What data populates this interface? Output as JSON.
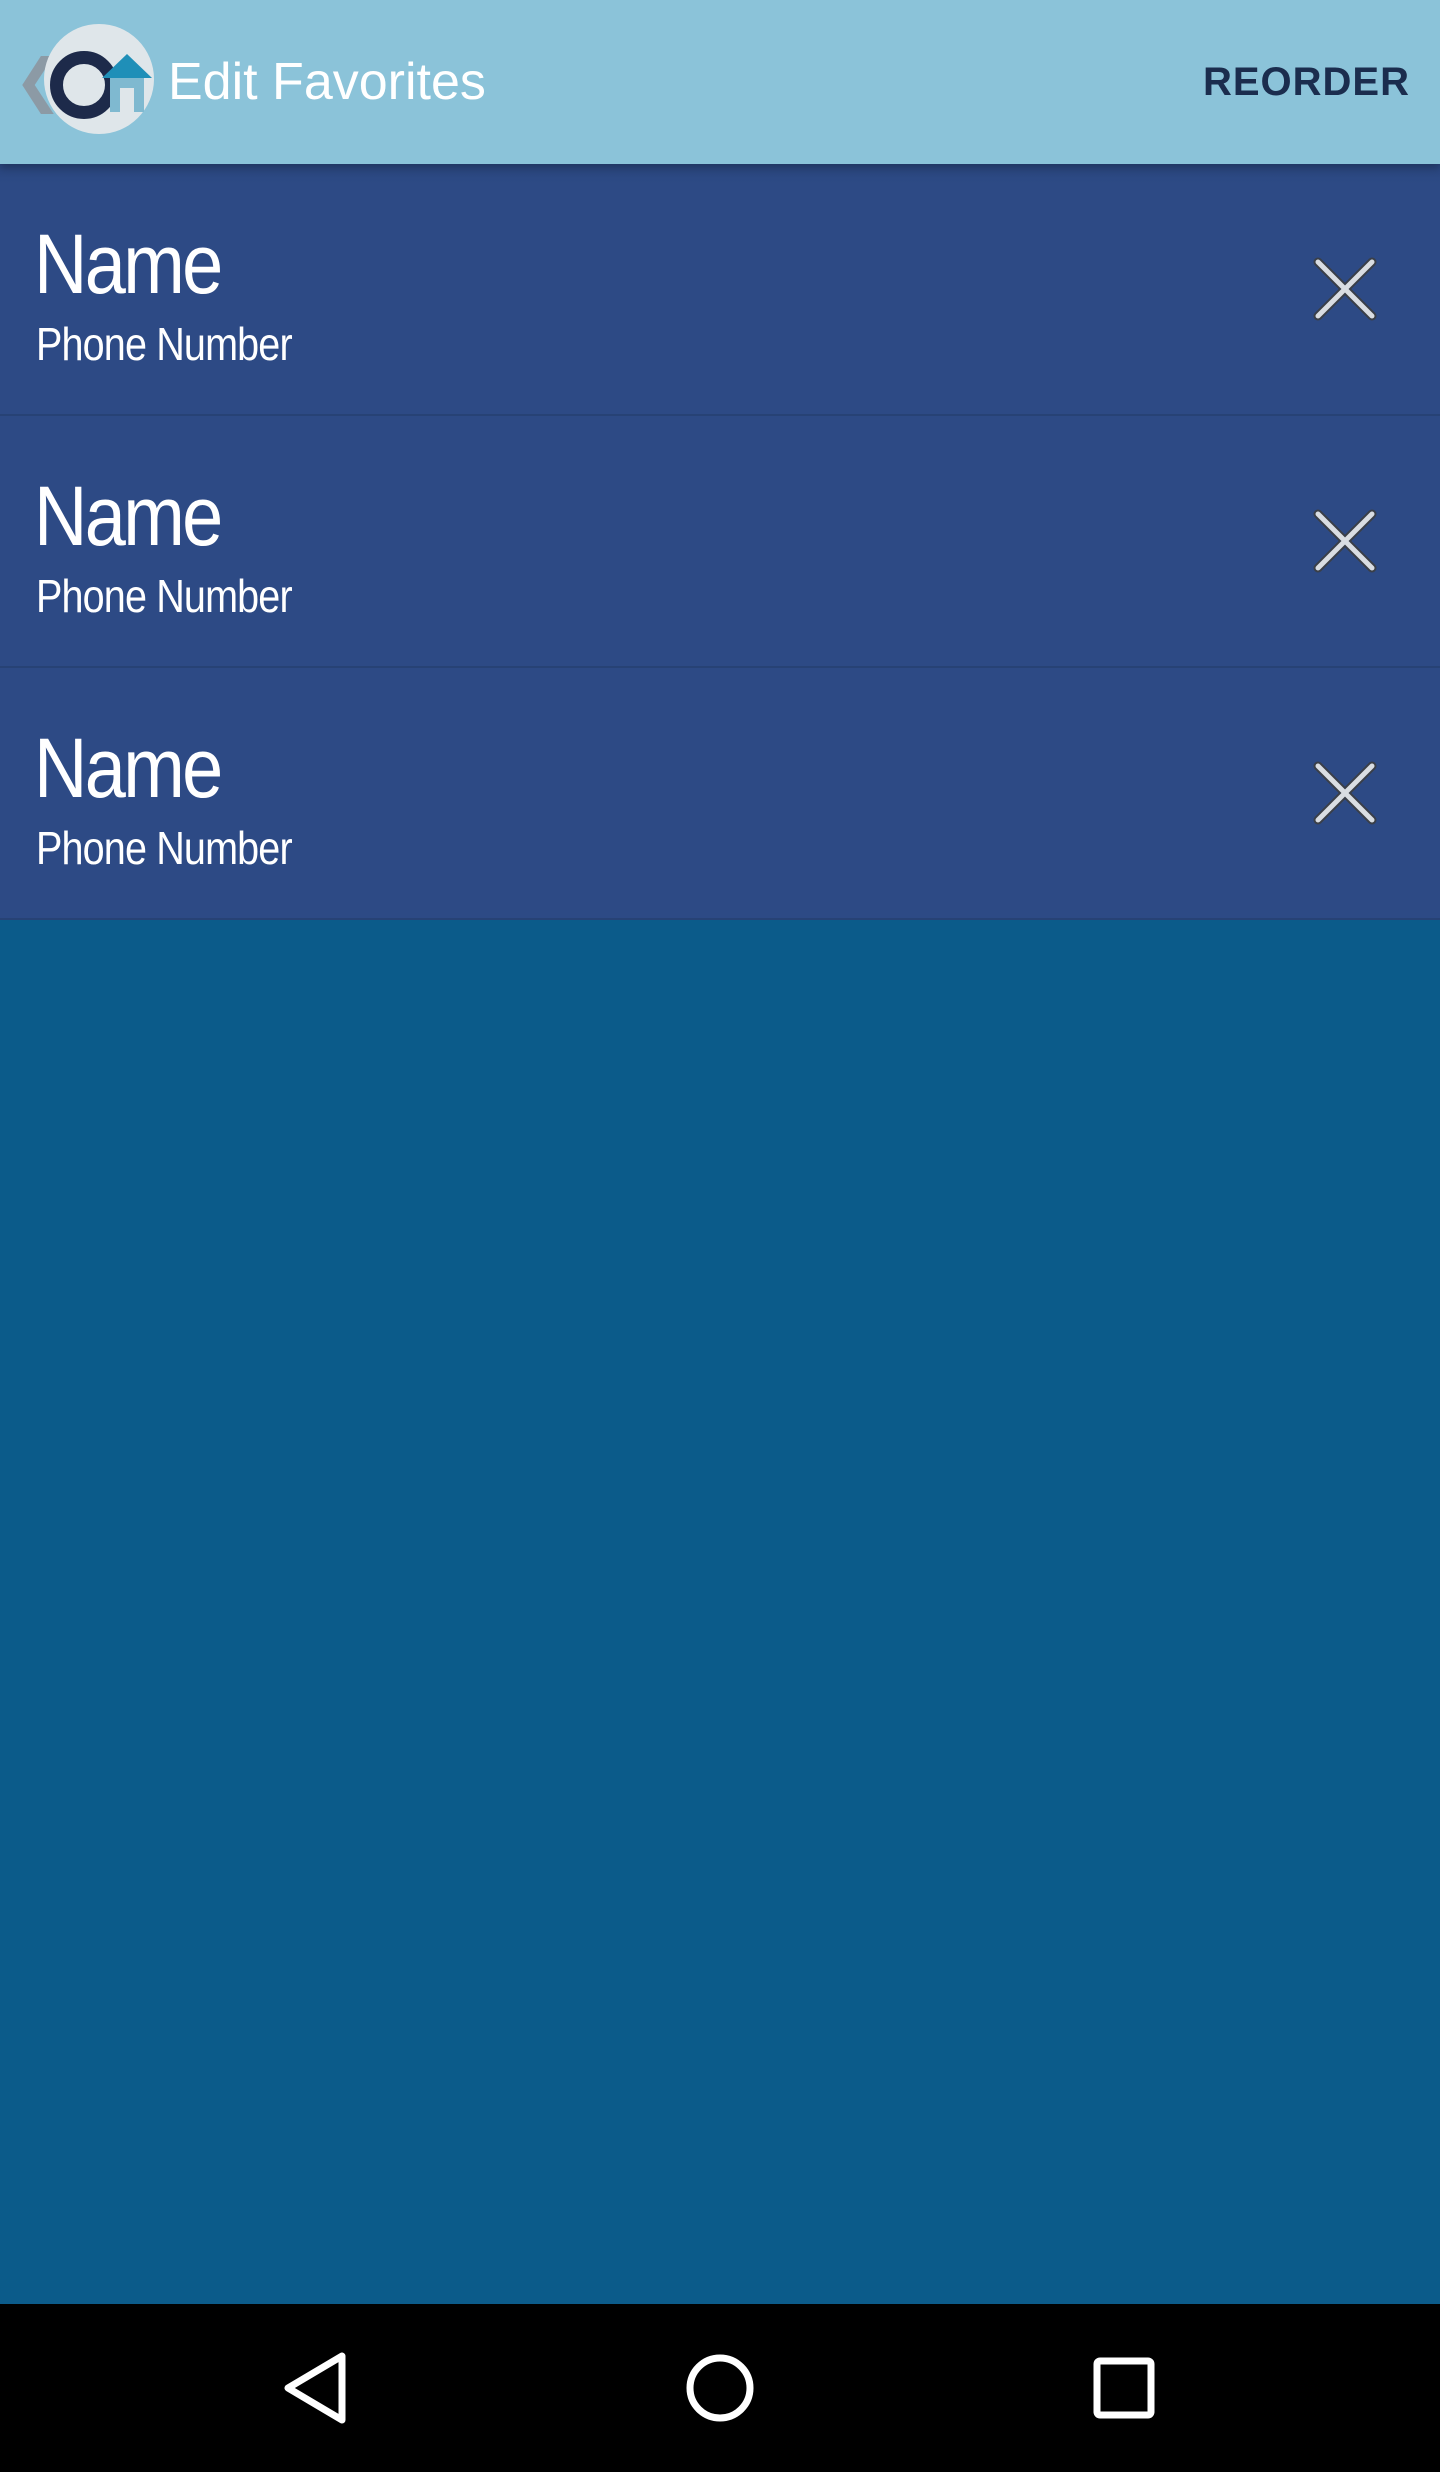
{
  "header": {
    "title": "Edit Favorites",
    "action_label": "REORDER",
    "back_icon": "chevron-left-icon",
    "logo_icon": "app-logo"
  },
  "favorites": [
    {
      "name": "Name",
      "phone": "Phone Number",
      "remove_icon": "close-icon"
    },
    {
      "name": "Name",
      "phone": "Phone Number",
      "remove_icon": "close-icon"
    },
    {
      "name": "Name",
      "phone": "Phone Number",
      "remove_icon": "close-icon"
    }
  ],
  "system_nav": {
    "back_icon": "nav-back-icon",
    "home_icon": "nav-home-icon",
    "recents_icon": "nav-recents-icon"
  },
  "colors": {
    "appbar": "#8bc3d9",
    "row": "#2d4a85",
    "background": "#0b5b8a",
    "reorder_text": "#1b2d4e",
    "navbar": "#000000"
  }
}
